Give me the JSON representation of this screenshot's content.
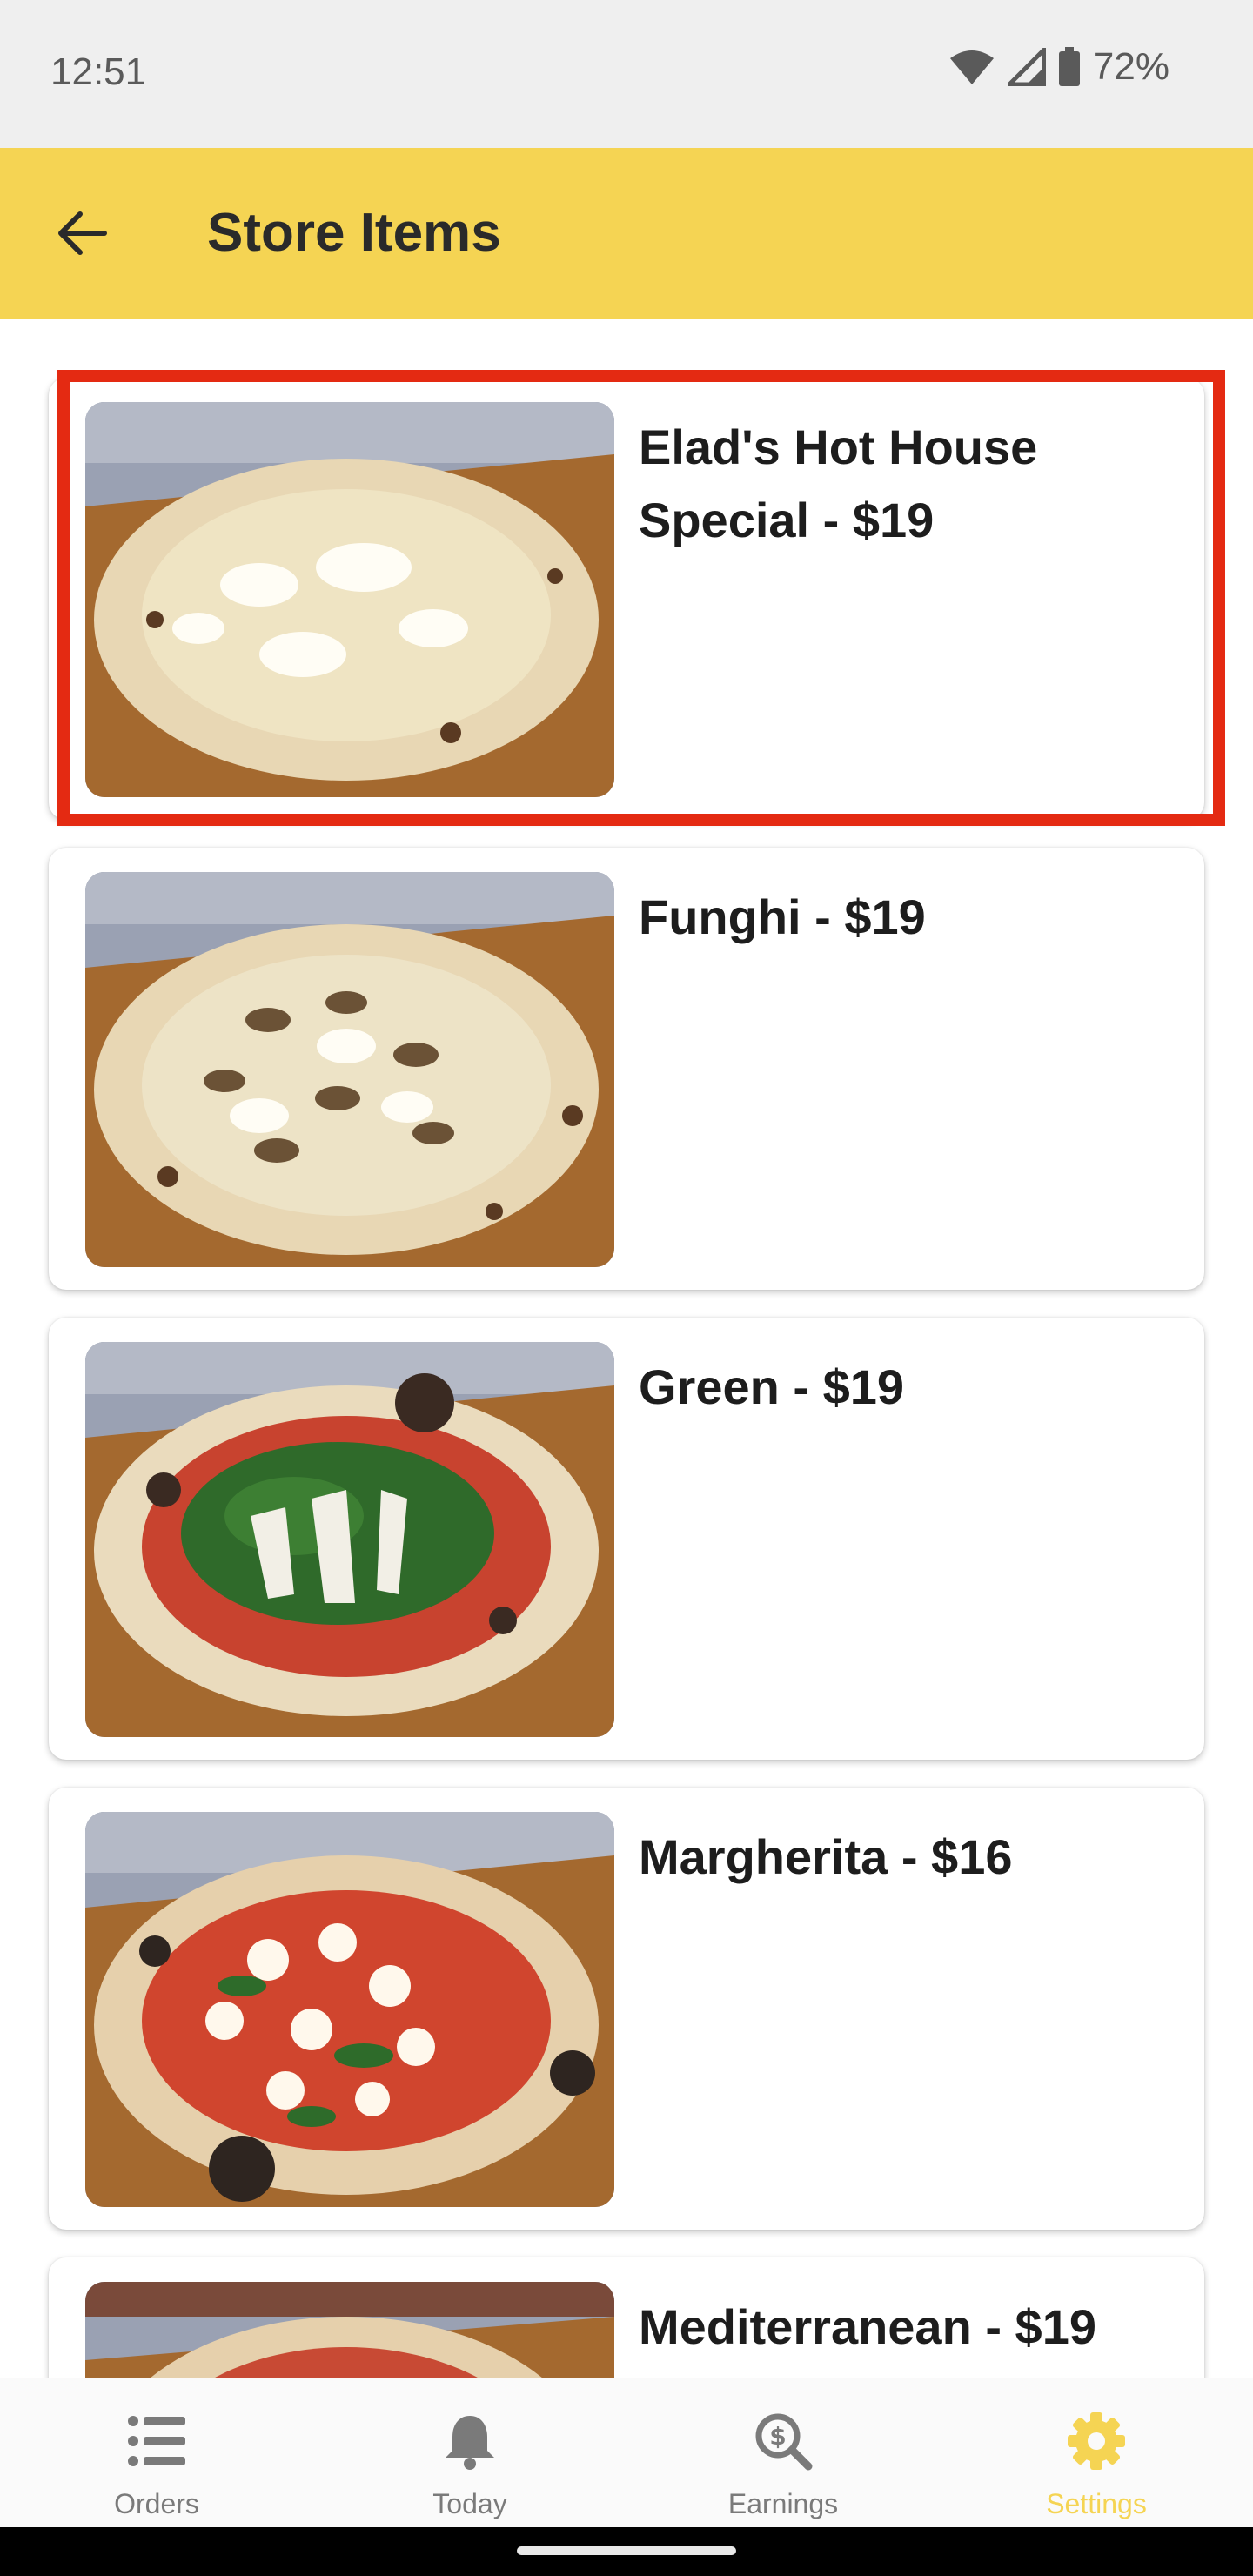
{
  "status": {
    "time": "12:51",
    "battery": "72%"
  },
  "header": {
    "title": "Store Items"
  },
  "items": [
    {
      "name": "Elad's Hot House Special - $19",
      "photo": "white-pizza"
    },
    {
      "name": "Funghi - $19",
      "photo": "mushroom-pizza"
    },
    {
      "name": "Green - $19",
      "photo": "arugula-pizza"
    },
    {
      "name": "Margherita - $16",
      "photo": "margherita-pizza"
    },
    {
      "name": "Mediterranean - $19",
      "photo": "mediterranean-pizza"
    }
  ],
  "nav": [
    {
      "label": "Orders",
      "icon": "list-icon",
      "active": false
    },
    {
      "label": "Today",
      "icon": "bell-icon",
      "active": false
    },
    {
      "label": "Earnings",
      "icon": "dollar-search-icon",
      "active": false
    },
    {
      "label": "Settings",
      "icon": "gear-icon",
      "active": true
    }
  ],
  "colors": {
    "accent": "#f5d453",
    "highlight": "#e42a12",
    "statusbar": "#efefef"
  }
}
